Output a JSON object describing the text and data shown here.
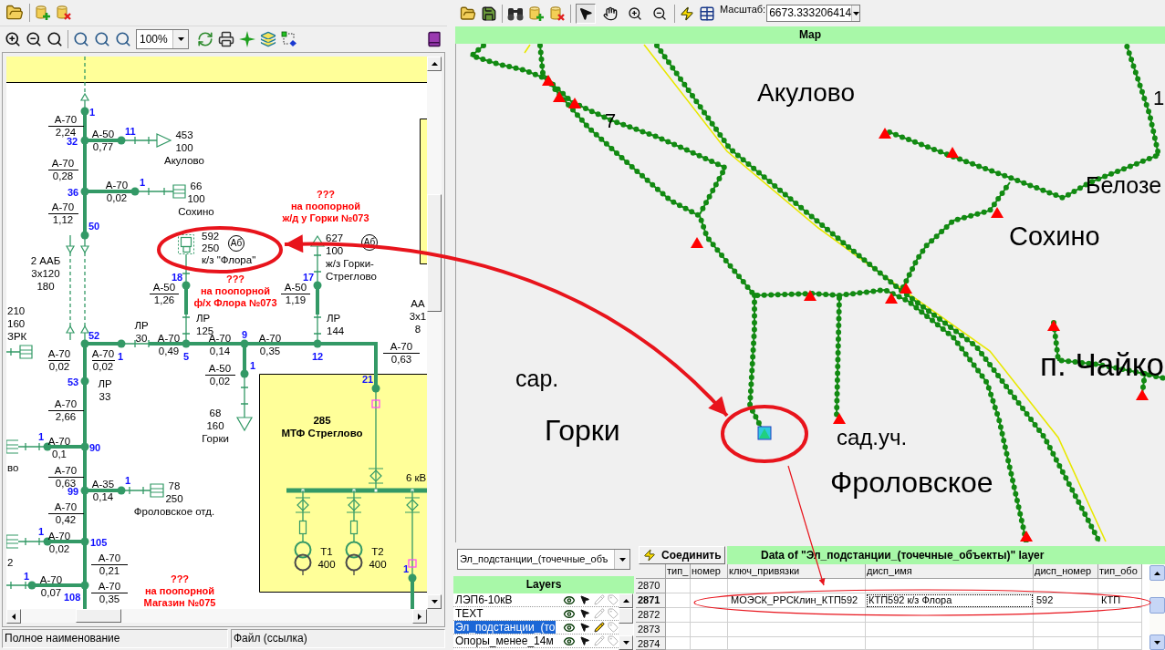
{
  "schematic_window": {
    "toolbar": {
      "zoom_value": "100%"
    },
    "diagram": {
      "cables": [
        {
          "kind": "ruled",
          "mark": "А-70",
          "length": "2,24"
        },
        {
          "kind": "inline",
          "mark": "А-50",
          "length": "0,77"
        },
        {
          "kind": "ruled",
          "mark": "А-70",
          "length": "0,28"
        },
        {
          "kind": "inline",
          "mark": "А-70",
          "length": "0,02"
        },
        {
          "kind": "ruled",
          "mark": "А-70",
          "length": "1,12"
        },
        {
          "kind": "ruled",
          "mark": "А-50",
          "length": "1,26"
        },
        {
          "kind": "ruled",
          "mark": "А-50",
          "length": "1,19"
        },
        {
          "kind": "ruled",
          "mark": "А-70",
          "length": "0,02"
        },
        {
          "kind": "ruled",
          "mark": "А-70",
          "length": "0,02"
        },
        {
          "kind": "inline",
          "mark": "А-70",
          "length": "0,49"
        },
        {
          "kind": "inline",
          "mark": "А-70",
          "length": "0,14"
        },
        {
          "kind": "inline",
          "mark": "А-70",
          "length": "0,35"
        },
        {
          "kind": "ruled",
          "mark": "А-70",
          "length": "0,63"
        },
        {
          "kind": "ruled",
          "mark": "А-50",
          "length": "0,02"
        },
        {
          "kind": "ruled",
          "mark": "А-70",
          "length": "2,66"
        },
        {
          "kind": "inline",
          "mark": "А-70",
          "length": "0,1"
        },
        {
          "kind": "ruled",
          "mark": "А-70",
          "length": "0,63"
        },
        {
          "kind": "inline",
          "mark": "А-35",
          "length": "0,14"
        },
        {
          "kind": "ruled",
          "mark": "А-70",
          "length": "0,42"
        },
        {
          "kind": "inline",
          "mark": "А-70",
          "length": "0,02"
        },
        {
          "kind": "ruled",
          "mark": "А-70",
          "length": "0,21"
        },
        {
          "kind": "inline",
          "mark": "А-70",
          "length": "0,07"
        },
        {
          "kind": "ruled",
          "mark": "А-70",
          "length": "0,35"
        }
      ],
      "node_numbers": [
        "1",
        "32",
        "11",
        "36",
        "1",
        "50",
        "18",
        "17",
        "52",
        "1",
        "5",
        "9",
        "12",
        "1",
        "53",
        "21",
        "1",
        "90",
        "99",
        "1",
        "1",
        "105",
        "1",
        "108",
        "1"
      ],
      "labels": [
        {
          "lines": [
            "453",
            "100",
            "Акулово"
          ]
        },
        {
          "lines": [
            "66",
            "100",
            "Сохино"
          ]
        },
        {
          "lines": [
            "2 ААБ",
            "3х120",
            "180"
          ]
        },
        {
          "lines": [
            "592",
            "250",
            "к/з \"Флора\""
          ]
        },
        {
          "lines": [
            "627",
            "100",
            "ж/з Горки-",
            "Стреглово"
          ]
        },
        {
          "lines": [
            "210",
            "160",
            "ЗРК"
          ]
        },
        {
          "lines": [
            "ЛР",
            "30"
          ]
        },
        {
          "lines": [
            "ЛР",
            "125"
          ]
        },
        {
          "lines": [
            "ЛР",
            "144"
          ]
        },
        {
          "lines": [
            "АА",
            "3х1",
            "8"
          ]
        },
        {
          "lines": [
            "ЛР",
            "33"
          ]
        },
        {
          "lines": [
            "68",
            "160",
            "Горки"
          ]
        },
        {
          "lines": [
            "во"
          ]
        },
        {
          "lines": [
            "78",
            "250",
            "Фроловское отд."
          ]
        },
        {
          "lines": [
            "2"
          ]
        }
      ],
      "notes": [
        {
          "lines": [
            "???",
            "на поопорной",
            "ж/д у Горки №073"
          ]
        },
        {
          "lines": [
            "???",
            "на поопорной",
            "ф/х Флора №073"
          ]
        },
        {
          "lines": [
            "???",
            "на поопорной",
            "Магазин №075"
          ]
        }
      ],
      "markers": [
        "Аб",
        "Аб"
      ],
      "substation": {
        "number": "285",
        "name": "МТФ Стреглово",
        "bus_label": "6 кВ",
        "transformers": [
          {
            "name": "Т1",
            "power": "400"
          },
          {
            "name": "Т2",
            "power": "400"
          }
        ]
      }
    },
    "status_bar": [
      "Полное наименование",
      "Файл (ссылка)"
    ]
  },
  "map_window": {
    "toolbar": {
      "tools": [
        {
          "selected": true
        },
        {
          "selected": false
        },
        {
          "selected": false
        },
        {
          "selected": false
        }
      ],
      "scale_label": "Масштаб:",
      "scale_value": "6673.333206414"
    },
    "map": {
      "title": "Map",
      "labels": [
        "Акулово",
        "7",
        "1",
        "Белозе",
        "Сохино",
        "п. Чайко",
        "сар.",
        "Горки",
        "сад.уч.",
        "Фроловское"
      ]
    },
    "layers_panel": {
      "layer_combo": "Эл_подстанции_(точечные_объ",
      "title": "Layers",
      "layers": [
        {
          "name": "ЛЭП6-10кВ",
          "selected": false,
          "visible": true,
          "selectable": true,
          "editable": false
        },
        {
          "name": "TEXT",
          "selected": false,
          "visible": true,
          "selectable": true,
          "editable": false
        },
        {
          "name": "Эл_подстанции_(то",
          "selected": true,
          "visible": true,
          "selectable": true,
          "editable": true
        },
        {
          "name": "Опоры_менее_14м",
          "selected": false,
          "visible": true,
          "selectable": true,
          "editable": false
        }
      ]
    },
    "data_panel": {
      "connect_button": "Соединить",
      "title": "Data of \"Эл_подстанции_(точечные_объекты)\" layer",
      "columns": [
        "тип_",
        "номер",
        "ключ_привязки",
        "дисп_имя",
        "дисп_номер",
        "тип_обо"
      ],
      "rows": [
        {
          "number": "2870",
          "selected": false
        },
        {
          "number": "2871",
          "selected": true,
          "binding_key": "МОЭСК_РРСКлин_КТП592",
          "disp_name": "КТП592 к/з Флора",
          "disp_number": "592",
          "column_7": "КТП"
        },
        {
          "number": "2872",
          "selected": false
        },
        {
          "number": "2873",
          "selected": false
        },
        {
          "number": "2874",
          "selected": false
        }
      ]
    }
  }
}
